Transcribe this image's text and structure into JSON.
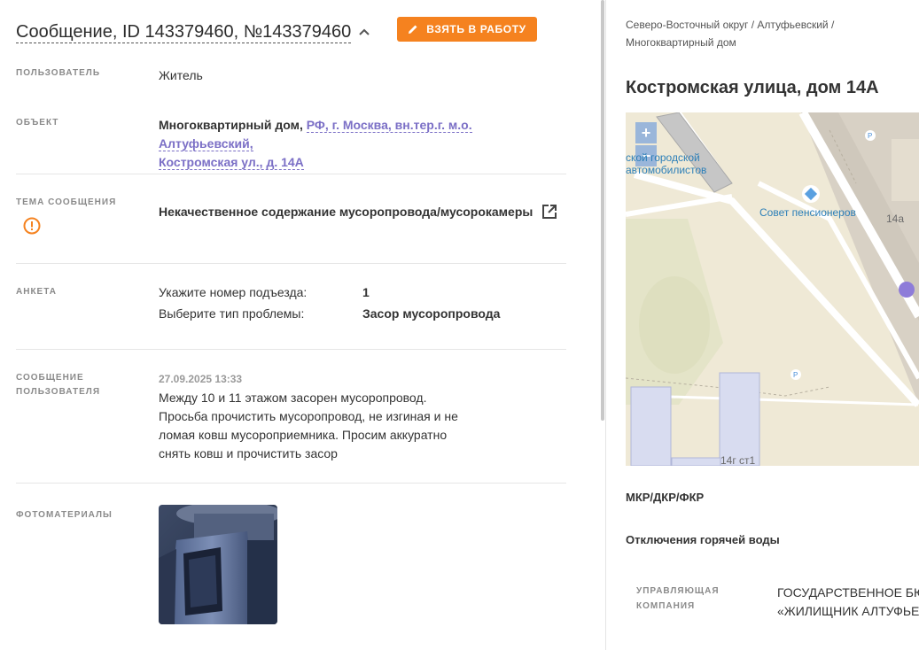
{
  "header": {
    "title": "Сообщение, ID 143379460, №143379460",
    "take_button_label": "ВЗЯТЬ В РАБОТУ",
    "accent_color": "#f5821f"
  },
  "user": {
    "label": "ПОЛЬЗОВАТЕЛЬ",
    "value": "Житель"
  },
  "object": {
    "label": "ОБЪЕКТ",
    "prefix": "Многоквартирный дом,",
    "address_line1": "РФ, г. Москва, вн.тер.г. м.о. Алтуфьевский,",
    "address_line2": "Костромская ул., д. 14А"
  },
  "topic": {
    "label": "ТЕМА СООБЩЕНИЯ",
    "value": "Некачественное содержание мусоропровода/мусорокамеры"
  },
  "survey": {
    "label": "АНКЕТА",
    "rows": [
      {
        "key": "Укажите номер подъезда:",
        "value": "1"
      },
      {
        "key": "Выберите тип проблемы:",
        "value": "Засор мусоропровода"
      }
    ]
  },
  "message": {
    "label_line1": "СООБЩЕНИЕ",
    "label_line2": "ПОЛЬЗОВАТЕЛЯ",
    "date": "27.09.2025 13:33",
    "lines": [
      "Между 10 и 11 этажом засорен мусоропровод.",
      "Просьба прочистить мусоропровод, не изгиная и не",
      "ломая ковш мусороприемника. Просим аккуратно",
      "снять ковш и прочистить засор"
    ]
  },
  "photos": {
    "label": "ФОТОМАТЕРИАЛЫ"
  },
  "right": {
    "breadcrumb_line1": "Северо-Восточный округ / Алтуфьевский /",
    "breadcrumb_line2": "Многоквартирный дом",
    "address_title": "Костромская улица, дом 14А",
    "map": {
      "zoom_in": "+",
      "zoom_out": "−",
      "label_school_line1": "ской городской",
      "label_school_line2": "автомобилистов",
      "label_council": "Совет пенсионеров",
      "label_14a": "14а",
      "label_14g": "14г ст1",
      "parking_label": "P"
    },
    "section_mkr": "МКР/ДКР/ФКР",
    "section_hot_water": "Отключения горячей воды",
    "mgmt_label_line1": "УПРАВЛЯЮЩАЯ",
    "mgmt_label_line2": "КОМПАНИЯ",
    "mgmt_value_line1": "ГОСУДАРСТВЕННОЕ БЮДЖ",
    "mgmt_value_line2": "«ЖИЛИЩНИК АЛТУФЬЕВ"
  },
  "icons": {
    "collapse": "chevron-up-icon",
    "take": "pencil-icon",
    "warning": "warning-circle-icon",
    "external": "external-link-icon"
  }
}
